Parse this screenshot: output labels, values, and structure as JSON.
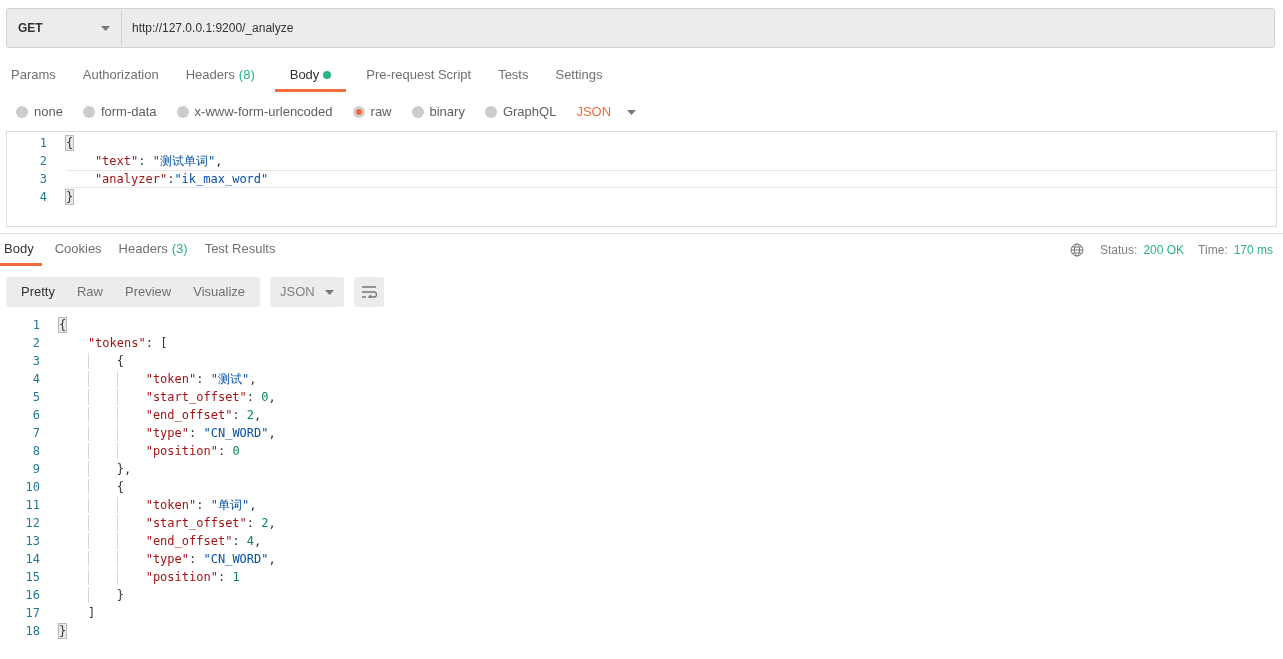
{
  "request": {
    "method": "GET",
    "url": "http://127.0.0.1:9200/_analyze"
  },
  "request_tabs": [
    {
      "label": "Params",
      "selected": false
    },
    {
      "label": "Authorization",
      "selected": false
    },
    {
      "label": "Headers",
      "count": "(8)",
      "selected": false
    },
    {
      "label": "Body",
      "dot": true,
      "selected": true
    },
    {
      "label": "Pre-request Script",
      "selected": false
    },
    {
      "label": "Tests",
      "selected": false
    },
    {
      "label": "Settings",
      "selected": false
    }
  ],
  "body_types": [
    {
      "label": "none",
      "selected": false
    },
    {
      "label": "form-data",
      "selected": false
    },
    {
      "label": "x-www-form-urlencoded",
      "selected": false
    },
    {
      "label": "raw",
      "selected": true
    },
    {
      "label": "binary",
      "selected": false
    },
    {
      "label": "GraphQL",
      "selected": false
    }
  ],
  "body_format": "JSON",
  "request_body": [
    {
      "number": "1",
      "active": false,
      "segments": [
        {
          "kind": "punct",
          "text": "{",
          "matched": true
        }
      ],
      "children": [
        {
          "number": "2",
          "active": false,
          "segments": [
            {
              "kind": "key",
              "text": "\"text\""
            },
            {
              "kind": "punct",
              "text": ": "
            },
            {
              "kind": "string",
              "text": "\"测试单词\""
            },
            {
              "kind": "punct",
              "text": ","
            }
          ]
        },
        {
          "number": "3",
          "active": true,
          "segments": [
            {
              "kind": "key",
              "text": "\"analyzer\""
            },
            {
              "kind": "punct",
              "text": ":"
            },
            {
              "kind": "string",
              "text": "\"ik_max_word\""
            }
          ]
        }
      ]
    },
    {
      "number": "4",
      "active": false,
      "segments": [
        {
          "kind": "punct",
          "text": "}",
          "matched": true
        }
      ]
    }
  ],
  "response_tabs": [
    {
      "label": "Body",
      "selected": true
    },
    {
      "label": "Cookies",
      "selected": false
    },
    {
      "label": "Headers",
      "count": "(3)",
      "selected": false
    },
    {
      "label": "Test Results",
      "selected": false
    }
  ],
  "status": {
    "status_label": "Status:",
    "status_value": "200 OK",
    "time_label": "Time:",
    "time_value": "170 ms"
  },
  "view_modes": [
    {
      "label": "Pretty",
      "selected": true
    },
    {
      "label": "Raw",
      "selected": false
    },
    {
      "label": "Preview",
      "selected": false
    },
    {
      "label": "Visualize",
      "selected": false
    }
  ],
  "response_format": "JSON",
  "response_body": [
    {
      "number": "1",
      "segments": [
        {
          "kind": "punct",
          "text": "{",
          "matched": true
        }
      ],
      "children": [
        {
          "number": "2",
          "segments": [
            {
              "kind": "key",
              "text": "\"tokens\""
            },
            {
              "kind": "punct",
              "text": ": ["
            }
          ],
          "children": [
            {
              "number": "3",
              "segments": [
                {
                  "kind": "punct",
                  "text": "{"
                }
              ],
              "children": [
                {
                  "number": "4",
                  "segments": [
                    {
                      "kind": "key",
                      "text": "\"token\""
                    },
                    {
                      "kind": "punct",
                      "text": ": "
                    },
                    {
                      "kind": "string",
                      "text": "\"测试\""
                    },
                    {
                      "kind": "punct",
                      "text": ","
                    }
                  ]
                },
                {
                  "number": "5",
                  "segments": [
                    {
                      "kind": "key",
                      "text": "\"start_offset\""
                    },
                    {
                      "kind": "punct",
                      "text": ": "
                    },
                    {
                      "kind": "number",
                      "text": "0"
                    },
                    {
                      "kind": "punct",
                      "text": ","
                    }
                  ]
                },
                {
                  "number": "6",
                  "segments": [
                    {
                      "kind": "key",
                      "text": "\"end_offset\""
                    },
                    {
                      "kind": "punct",
                      "text": ": "
                    },
                    {
                      "kind": "number",
                      "text": "2"
                    },
                    {
                      "kind": "punct",
                      "text": ","
                    }
                  ]
                },
                {
                  "number": "7",
                  "segments": [
                    {
                      "kind": "key",
                      "text": "\"type\""
                    },
                    {
                      "kind": "punct",
                      "text": ": "
                    },
                    {
                      "kind": "string",
                      "text": "\"CN_WORD\""
                    },
                    {
                      "kind": "punct",
                      "text": ","
                    }
                  ]
                },
                {
                  "number": "8",
                  "segments": [
                    {
                      "kind": "key",
                      "text": "\"position\""
                    },
                    {
                      "kind": "punct",
                      "text": ": "
                    },
                    {
                      "kind": "number",
                      "text": "0"
                    }
                  ]
                }
              ]
            },
            {
              "number": "9",
              "segments": [
                {
                  "kind": "punct",
                  "text": "},"
                }
              ]
            },
            {
              "number": "10",
              "segments": [
                {
                  "kind": "punct",
                  "text": "{"
                }
              ],
              "children": [
                {
                  "number": "11",
                  "segments": [
                    {
                      "kind": "key",
                      "text": "\"token\""
                    },
                    {
                      "kind": "punct",
                      "text": ": "
                    },
                    {
                      "kind": "string",
                      "text": "\"单词\""
                    },
                    {
                      "kind": "punct",
                      "text": ","
                    }
                  ]
                },
                {
                  "number": "12",
                  "segments": [
                    {
                      "kind": "key",
                      "text": "\"start_offset\""
                    },
                    {
                      "kind": "punct",
                      "text": ": "
                    },
                    {
                      "kind": "number",
                      "text": "2"
                    },
                    {
                      "kind": "punct",
                      "text": ","
                    }
                  ]
                },
                {
                  "number": "13",
                  "segments": [
                    {
                      "kind": "key",
                      "text": "\"end_offset\""
                    },
                    {
                      "kind": "punct",
                      "text": ": "
                    },
                    {
                      "kind": "number",
                      "text": "4"
                    },
                    {
                      "kind": "punct",
                      "text": ","
                    }
                  ]
                },
                {
                  "number": "14",
                  "segments": [
                    {
                      "kind": "key",
                      "text": "\"type\""
                    },
                    {
                      "kind": "punct",
                      "text": ": "
                    },
                    {
                      "kind": "string",
                      "text": "\"CN_WORD\""
                    },
                    {
                      "kind": "punct",
                      "text": ","
                    }
                  ]
                },
                {
                  "number": "15",
                  "segments": [
                    {
                      "kind": "key",
                      "text": "\"position\""
                    },
                    {
                      "kind": "punct",
                      "text": ": "
                    },
                    {
                      "kind": "number",
                      "text": "1"
                    }
                  ]
                }
              ]
            },
            {
              "number": "16",
              "segments": [
                {
                  "kind": "punct",
                  "text": "}"
                }
              ]
            }
          ]
        },
        {
          "number": "17",
          "segments": [
            {
              "kind": "punct",
              "text": "]"
            }
          ]
        }
      ]
    },
    {
      "number": "18",
      "segments": [
        {
          "kind": "punct",
          "text": "}",
          "matched": true
        }
      ]
    }
  ]
}
